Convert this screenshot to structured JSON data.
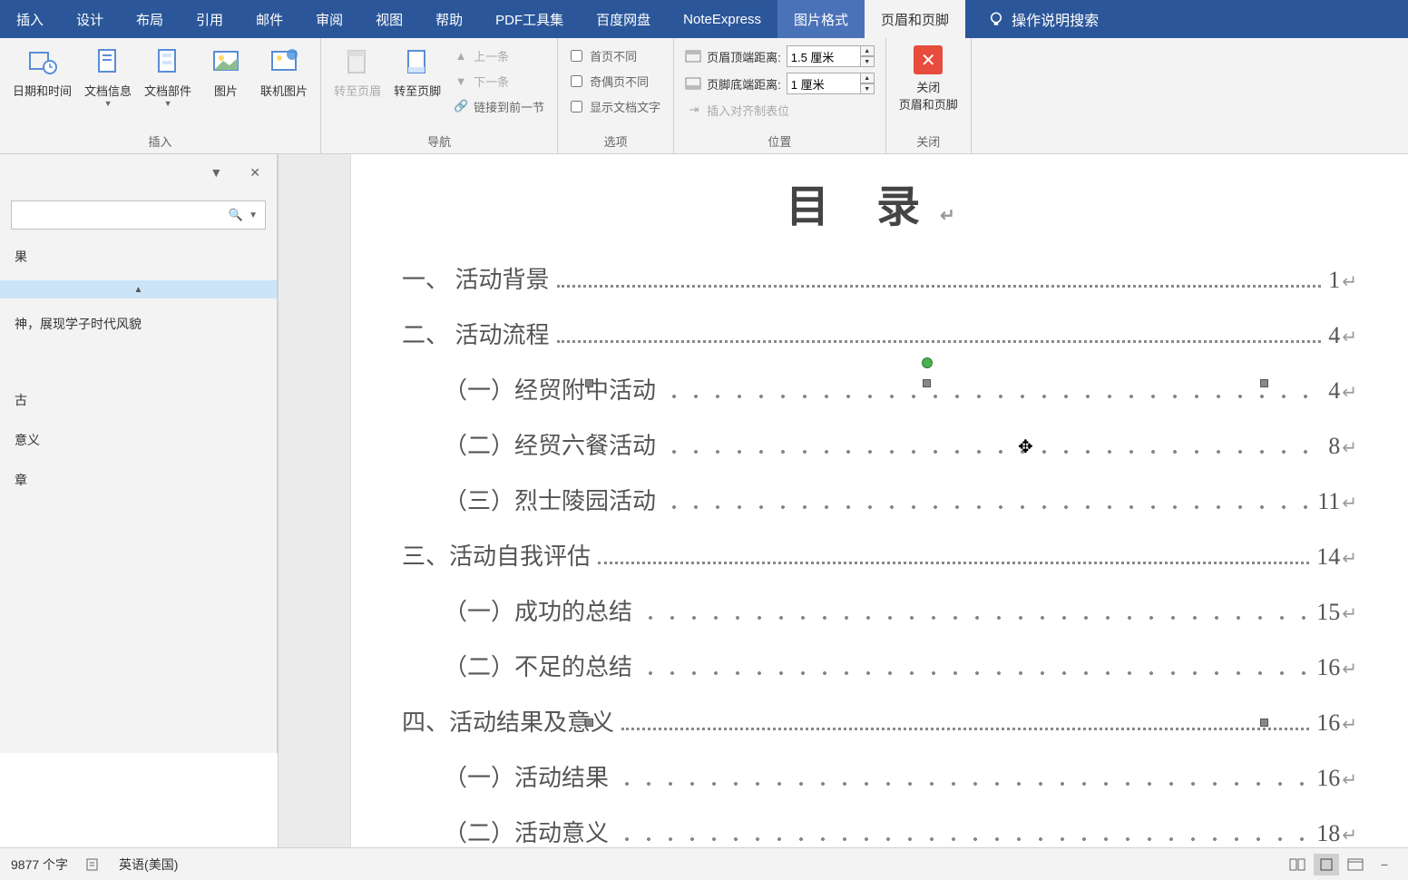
{
  "ribbon": {
    "tabs": [
      "插入",
      "设计",
      "布局",
      "引用",
      "邮件",
      "审阅",
      "视图",
      "帮助",
      "PDF工具集",
      "百度网盘",
      "NoteExpress",
      "图片格式",
      "页眉和页脚"
    ],
    "active_tab": "页眉和页脚",
    "highlight_tab": "图片格式",
    "help_search": "操作说明搜索"
  },
  "toolbar": {
    "insert_group": "插入",
    "date_time": "日期和时间",
    "doc_info": "文档信息",
    "doc_parts": "文档部件",
    "picture": "图片",
    "online_picture": "联机图片",
    "nav_group": "导航",
    "goto_header": "转至页眉",
    "goto_footer": "转至页脚",
    "prev": "上一条",
    "next": "下一条",
    "link_prev": "链接到前一节",
    "options_group": "选项",
    "diff_first": "首页不同",
    "diff_odd_even": "奇偶页不同",
    "show_doc_text": "显示文档文字",
    "position_group": "位置",
    "header_top_label": "页眉顶端距离:",
    "header_top_value": "1.5 厘米",
    "footer_bottom_label": "页脚底端距离:",
    "footer_bottom_value": "1 厘米",
    "insert_align_tab": "插入对齐制表位",
    "close_group": "关闭",
    "close_btn_line1": "关闭",
    "close_btn_line2": "页眉和页脚"
  },
  "nav": {
    "search_placeholder": "",
    "result_suffix": "果",
    "item1_text": "神，展现学子时代风貌",
    "item2": "古",
    "item3": "意义",
    "item4": "章"
  },
  "document": {
    "title": "目 录",
    "toc": [
      {
        "level": 1,
        "text": "一、  活动背景",
        "page": "1"
      },
      {
        "level": 1,
        "text": "二、  活动流程",
        "page": "4"
      },
      {
        "level": 2,
        "text": "（一）经贸附中活动",
        "page": "4"
      },
      {
        "level": 2,
        "text": "（二）经贸六餐活动",
        "page": "8"
      },
      {
        "level": 2,
        "text": "（三）烈士陵园活动",
        "page": "11"
      },
      {
        "level": 1,
        "text": "三、活动自我评估",
        "page": "14"
      },
      {
        "level": 2,
        "text": "（一）成功的总结",
        "page": "15"
      },
      {
        "level": 2,
        "text": "（二）不足的总结",
        "page": "16"
      },
      {
        "level": 1,
        "text": "四、活动结果及意义",
        "page": "16"
      },
      {
        "level": 2,
        "text": "（一）活动结果",
        "page": "16"
      },
      {
        "level": 2,
        "text": "（二）活动意义",
        "page": "18"
      }
    ]
  },
  "status": {
    "word_count": "9877 个字",
    "language": "英语(美国)"
  }
}
